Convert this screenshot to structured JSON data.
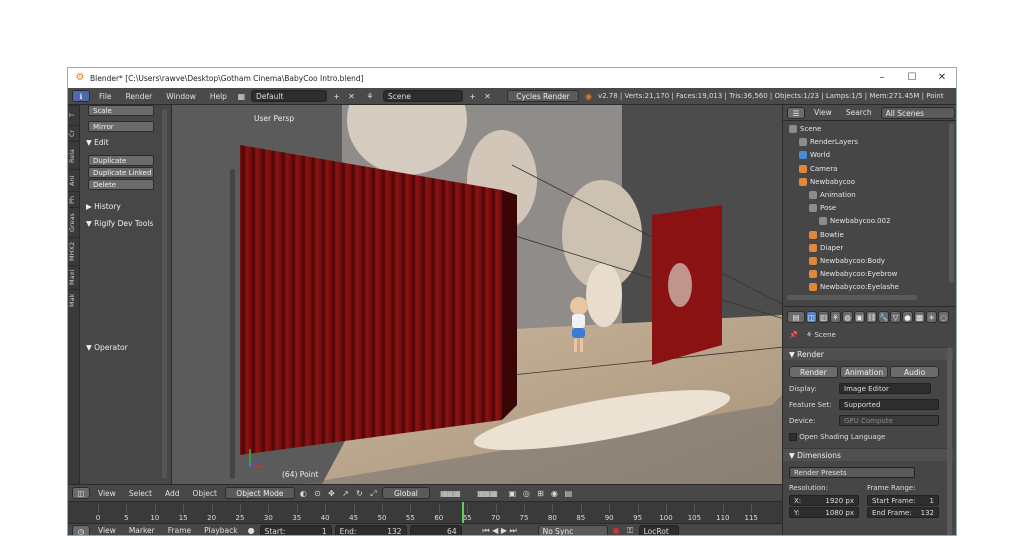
{
  "window": {
    "title": "Blender* [C:\\Users\\rawve\\Desktop\\Gotham Cinema\\BabyCoo Intro.blend]",
    "min": "–",
    "max": "☐",
    "close": "✕"
  },
  "infobar": {
    "menus": [
      "File",
      "Render",
      "Window",
      "Help"
    ],
    "layout": "Default",
    "scene": "Scene",
    "engine": "Cycles Render",
    "stats": "v2.78 | Verts:21,170 | Faces:19,013 | Tris:36,560 | Objects:1/23 | Lamps:1/5 | Mem:271.45M | Point"
  },
  "toolshelf": {
    "tabs": [
      "T",
      "Cr",
      "Rela",
      "Ani",
      "Ph",
      "Greas",
      "MHX2",
      "Maxi",
      "Mak"
    ],
    "scale": "Scale",
    "mirror": "Mirror",
    "edit_header": "▼ Edit",
    "duplicate": "Duplicate",
    "duplicate_linked": "Duplicate Linked",
    "delete": "Delete",
    "history": "▶ History",
    "rigify": "▼ Rigify Dev Tools",
    "operator": "▼ Operator"
  },
  "viewport": {
    "label": "User Persp",
    "status": "(64) Point"
  },
  "view3d_header": {
    "menus": [
      "View",
      "Select",
      "Add",
      "Object"
    ],
    "mode": "Object Mode",
    "orientation": "Global"
  },
  "timeline": {
    "ticks": [
      "0",
      "5",
      "10",
      "15",
      "20",
      "25",
      "30",
      "35",
      "40",
      "45",
      "50",
      "55",
      "60",
      "65",
      "70",
      "75",
      "80",
      "85",
      "90",
      "95",
      "100",
      "105",
      "110",
      "115"
    ],
    "current_frame": 64
  },
  "timeline_header": {
    "menus": [
      "View",
      "Marker",
      "Frame",
      "Playback"
    ],
    "start_label": "Start:",
    "start_value": "1",
    "end_label": "End:",
    "end_value": "132",
    "frame_value": "64",
    "sync": "No Sync",
    "keying": "LocRot"
  },
  "outliner": {
    "menus": [
      "View",
      "Search"
    ],
    "filter": "All Scenes",
    "rows": [
      {
        "label": "Scene",
        "color": "#8c8c8c"
      },
      {
        "label": "RenderLayers",
        "color": "#8c8c8c"
      },
      {
        "label": "World",
        "color": "#4a8ad9"
      },
      {
        "label": "Camera",
        "color": "#e0873a"
      },
      {
        "label": "Newbabycoo",
        "color": "#e0873a"
      },
      {
        "label": "Animation",
        "color": "#8c8c8c"
      },
      {
        "label": "Pose",
        "color": "#8c8c8c"
      },
      {
        "label": "Newbabycoo.002",
        "color": "#8c8c8c"
      },
      {
        "label": "Bowtie",
        "color": "#e0873a"
      },
      {
        "label": "Diaper",
        "color": "#e0873a"
      },
      {
        "label": "Newbabycoo:Body",
        "color": "#e0873a"
      },
      {
        "label": "Newbabycoo:Eyebrow",
        "color": "#e0873a"
      },
      {
        "label": "Newbabycoo:Eyelashe",
        "color": "#e0873a"
      }
    ]
  },
  "properties": {
    "scene_label": "Scene",
    "render_header": "▼ Render",
    "render_btn": "Render",
    "animation_btn": "Animation",
    "audio_btn": "Audio",
    "display_label": "Display:",
    "display_value": "Image Editor",
    "featureset_label": "Feature Set:",
    "featureset_value": "Supported",
    "device_label": "Device:",
    "device_value": "GPU Compute",
    "osl_label": "Open Shading Language",
    "dimensions_header": "▼ Dimensions",
    "presets": "Render Presets",
    "resolution_label": "Resolution:",
    "framerange_label": "Frame Range:",
    "res_x": "X:",
    "res_x_value": "1920 px",
    "res_y": "Y:",
    "res_y_value": "1080 px",
    "start_frame_label": "Start Frame:",
    "start_frame_value": "1",
    "end_frame_label": "End Frame:",
    "end_frame_value": "132"
  },
  "colors": {
    "accent": "#e87d0d",
    "selected": "#5680c2",
    "curtain": "#8a1010"
  }
}
